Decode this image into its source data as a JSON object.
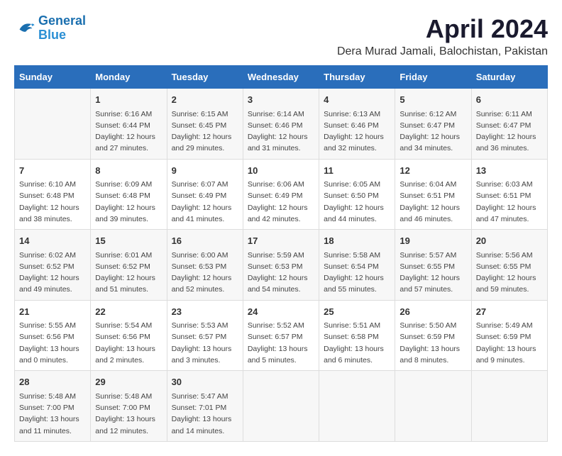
{
  "header": {
    "logo_line1": "General",
    "logo_line2": "Blue",
    "month": "April 2024",
    "location": "Dera Murad Jamali, Balochistan, Pakistan"
  },
  "days_of_week": [
    "Sunday",
    "Monday",
    "Tuesday",
    "Wednesday",
    "Thursday",
    "Friday",
    "Saturday"
  ],
  "weeks": [
    [
      {
        "day": "",
        "content": ""
      },
      {
        "day": "1",
        "content": "Sunrise: 6:16 AM\nSunset: 6:44 PM\nDaylight: 12 hours\nand 27 minutes."
      },
      {
        "day": "2",
        "content": "Sunrise: 6:15 AM\nSunset: 6:45 PM\nDaylight: 12 hours\nand 29 minutes."
      },
      {
        "day": "3",
        "content": "Sunrise: 6:14 AM\nSunset: 6:46 PM\nDaylight: 12 hours\nand 31 minutes."
      },
      {
        "day": "4",
        "content": "Sunrise: 6:13 AM\nSunset: 6:46 PM\nDaylight: 12 hours\nand 32 minutes."
      },
      {
        "day": "5",
        "content": "Sunrise: 6:12 AM\nSunset: 6:47 PM\nDaylight: 12 hours\nand 34 minutes."
      },
      {
        "day": "6",
        "content": "Sunrise: 6:11 AM\nSunset: 6:47 PM\nDaylight: 12 hours\nand 36 minutes."
      }
    ],
    [
      {
        "day": "7",
        "content": "Sunrise: 6:10 AM\nSunset: 6:48 PM\nDaylight: 12 hours\nand 38 minutes."
      },
      {
        "day": "8",
        "content": "Sunrise: 6:09 AM\nSunset: 6:48 PM\nDaylight: 12 hours\nand 39 minutes."
      },
      {
        "day": "9",
        "content": "Sunrise: 6:07 AM\nSunset: 6:49 PM\nDaylight: 12 hours\nand 41 minutes."
      },
      {
        "day": "10",
        "content": "Sunrise: 6:06 AM\nSunset: 6:49 PM\nDaylight: 12 hours\nand 42 minutes."
      },
      {
        "day": "11",
        "content": "Sunrise: 6:05 AM\nSunset: 6:50 PM\nDaylight: 12 hours\nand 44 minutes."
      },
      {
        "day": "12",
        "content": "Sunrise: 6:04 AM\nSunset: 6:51 PM\nDaylight: 12 hours\nand 46 minutes."
      },
      {
        "day": "13",
        "content": "Sunrise: 6:03 AM\nSunset: 6:51 PM\nDaylight: 12 hours\nand 47 minutes."
      }
    ],
    [
      {
        "day": "14",
        "content": "Sunrise: 6:02 AM\nSunset: 6:52 PM\nDaylight: 12 hours\nand 49 minutes."
      },
      {
        "day": "15",
        "content": "Sunrise: 6:01 AM\nSunset: 6:52 PM\nDaylight: 12 hours\nand 51 minutes."
      },
      {
        "day": "16",
        "content": "Sunrise: 6:00 AM\nSunset: 6:53 PM\nDaylight: 12 hours\nand 52 minutes."
      },
      {
        "day": "17",
        "content": "Sunrise: 5:59 AM\nSunset: 6:53 PM\nDaylight: 12 hours\nand 54 minutes."
      },
      {
        "day": "18",
        "content": "Sunrise: 5:58 AM\nSunset: 6:54 PM\nDaylight: 12 hours\nand 55 minutes."
      },
      {
        "day": "19",
        "content": "Sunrise: 5:57 AM\nSunset: 6:55 PM\nDaylight: 12 hours\nand 57 minutes."
      },
      {
        "day": "20",
        "content": "Sunrise: 5:56 AM\nSunset: 6:55 PM\nDaylight: 12 hours\nand 59 minutes."
      }
    ],
    [
      {
        "day": "21",
        "content": "Sunrise: 5:55 AM\nSunset: 6:56 PM\nDaylight: 13 hours\nand 0 minutes."
      },
      {
        "day": "22",
        "content": "Sunrise: 5:54 AM\nSunset: 6:56 PM\nDaylight: 13 hours\nand 2 minutes."
      },
      {
        "day": "23",
        "content": "Sunrise: 5:53 AM\nSunset: 6:57 PM\nDaylight: 13 hours\nand 3 minutes."
      },
      {
        "day": "24",
        "content": "Sunrise: 5:52 AM\nSunset: 6:57 PM\nDaylight: 13 hours\nand 5 minutes."
      },
      {
        "day": "25",
        "content": "Sunrise: 5:51 AM\nSunset: 6:58 PM\nDaylight: 13 hours\nand 6 minutes."
      },
      {
        "day": "26",
        "content": "Sunrise: 5:50 AM\nSunset: 6:59 PM\nDaylight: 13 hours\nand 8 minutes."
      },
      {
        "day": "27",
        "content": "Sunrise: 5:49 AM\nSunset: 6:59 PM\nDaylight: 13 hours\nand 9 minutes."
      }
    ],
    [
      {
        "day": "28",
        "content": "Sunrise: 5:48 AM\nSunset: 7:00 PM\nDaylight: 13 hours\nand 11 minutes."
      },
      {
        "day": "29",
        "content": "Sunrise: 5:48 AM\nSunset: 7:00 PM\nDaylight: 13 hours\nand 12 minutes."
      },
      {
        "day": "30",
        "content": "Sunrise: 5:47 AM\nSunset: 7:01 PM\nDaylight: 13 hours\nand 14 minutes."
      },
      {
        "day": "",
        "content": ""
      },
      {
        "day": "",
        "content": ""
      },
      {
        "day": "",
        "content": ""
      },
      {
        "day": "",
        "content": ""
      }
    ]
  ]
}
